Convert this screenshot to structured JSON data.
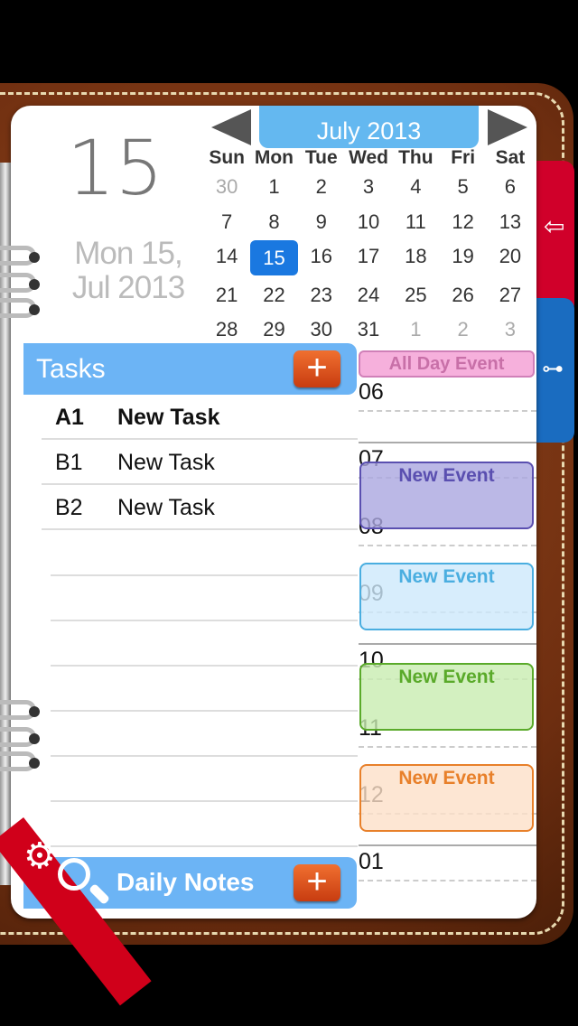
{
  "header": {
    "big_day": "15",
    "date_line1": "Mon 15,",
    "date_line2": "Jul 2013",
    "month_title": "July 2013"
  },
  "calendar": {
    "weekdays": [
      "Sun",
      "Mon",
      "Tue",
      "Wed",
      "Thu",
      "Fri",
      "Sat"
    ],
    "days": [
      "30",
      "1",
      "2",
      "3",
      "4",
      "5",
      "6",
      "7",
      "8",
      "9",
      "10",
      "11",
      "12",
      "13",
      "14",
      "15",
      "16",
      "17",
      "18",
      "19",
      "20",
      "21",
      "22",
      "23",
      "24",
      "25",
      "26",
      "27",
      "28",
      "29",
      "30",
      "31",
      "1",
      "2",
      "3"
    ],
    "dim_indices": [
      0,
      32,
      33,
      34
    ],
    "selected_index": 15
  },
  "tasks": {
    "title": "Tasks",
    "add": "+",
    "items": [
      {
        "priority": "A1",
        "title": "New Task",
        "bold": true
      },
      {
        "priority": "B1",
        "title": "New Task"
      },
      {
        "priority": "B2",
        "title": "New Task"
      }
    ]
  },
  "notes": {
    "title": "Daily Notes",
    "add": "+"
  },
  "timeline": {
    "all_day": "All Day Event",
    "hours": [
      "06",
      "07",
      "08",
      "09",
      "10",
      "11",
      "12",
      "01"
    ],
    "events": [
      {
        "title": "New Event",
        "color": "#5a4fb0",
        "bg": "#aaa6e0"
      },
      {
        "title": "New Event",
        "color": "#4aaee0",
        "bg": "#cde9fb"
      },
      {
        "title": "New Event",
        "color": "#5aaa2a",
        "bg": "#c8ecb0"
      },
      {
        "title": "New Event",
        "color": "#e8802a",
        "bg": "#fde0c8"
      }
    ]
  },
  "colors": {
    "accent": "#64b8f0",
    "selected": "#1a78e0",
    "ribbon": "#d0001a"
  }
}
